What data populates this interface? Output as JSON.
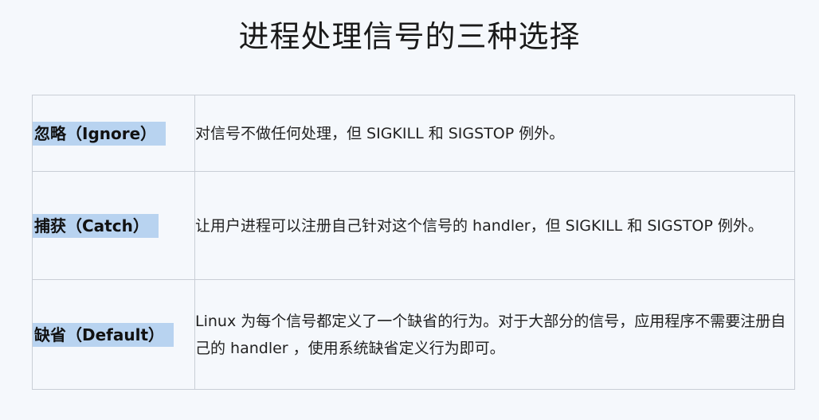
{
  "title": "进程处理信号的三种选择",
  "rows": [
    {
      "name": "忽略（Ignore）",
      "desc": "对信号不做任何处理，但 SIGKILL 和 SIGSTOP 例外。"
    },
    {
      "name": "捕获（Catch）",
      "desc": "让用户进程可以注册自己针对这个信号的 handler，但 SIGKILL 和 SIGSTOP 例外。"
    },
    {
      "name": "缺省（Default）",
      "desc": "Linux 为每个信号都定义了一个缺省的行为。对于大部分的信号，应用程序不需要注册自己的 handler ，使用系统缺省定义行为即可。"
    }
  ],
  "colors": {
    "background": "#f5f8fc",
    "highlight": "#b8d3f0",
    "border": "#c9ced6"
  }
}
